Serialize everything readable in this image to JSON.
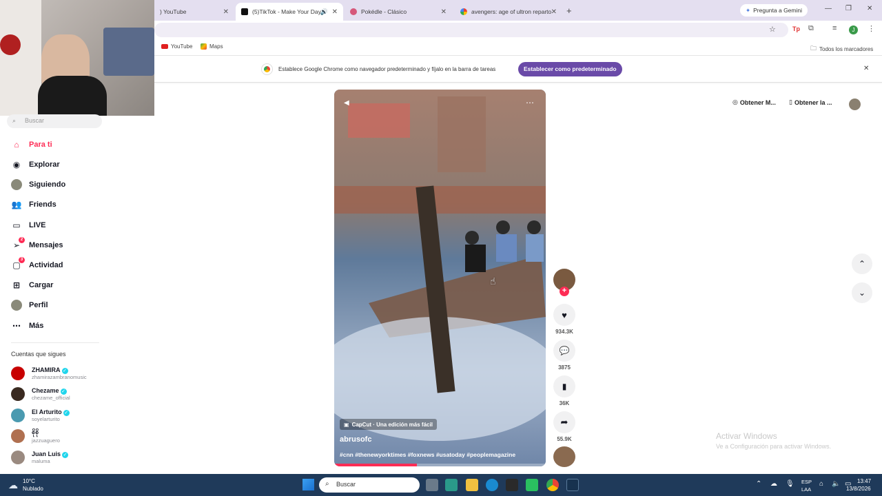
{
  "browser": {
    "tabs": [
      {
        "label": ") YouTube"
      },
      {
        "label": "(5)TikTok - Make Your Day"
      },
      {
        "label": "Pokédle - Clásico"
      },
      {
        "label": "avengers: age of ultron reparto"
      }
    ],
    "gemini_label": "Pregunta a Gemini",
    "bookmarks": [
      {
        "label": "YouTube"
      },
      {
        "label": "Maps"
      }
    ],
    "all_bookmarks": "Todos los marcadores",
    "infobar": {
      "message": "Establece Google Chrome como navegador predeterminado y fíjalo en la barra de tareas",
      "button": "Establecer como predeterminado"
    }
  },
  "sidebar": {
    "search_placeholder": "Buscar",
    "nav": [
      {
        "label": "Para ti",
        "icon": "home-icon"
      },
      {
        "label": "Explorar",
        "icon": "compass-icon"
      },
      {
        "label": "Siguiendo",
        "icon": "avatar-icon"
      },
      {
        "label": "Friends",
        "icon": "friends-icon"
      },
      {
        "label": "LIVE",
        "icon": "live-icon"
      },
      {
        "label": "Mensajes",
        "icon": "messages-icon",
        "badge": "2"
      },
      {
        "label": "Actividad",
        "icon": "activity-icon",
        "badge": "3"
      },
      {
        "label": "Cargar",
        "icon": "upload-icon"
      },
      {
        "label": "Perfil",
        "icon": "profile-icon"
      },
      {
        "label": "Más",
        "icon": "more-icon"
      }
    ],
    "following_title": "Cuentas que sigues",
    "following": [
      {
        "name": "ZHAMIRA",
        "handle": "zhamirazambranomusic",
        "verified": true,
        "color": "#c80000"
      },
      {
        "name": "Chezame",
        "handle": "chezame_official",
        "verified": true,
        "color": "#3a2a20"
      },
      {
        "name": "El Arturito",
        "handle": "soyelarturito",
        "verified": true,
        "color": "#4a9ab0"
      },
      {
        "name": "စိုစို",
        "handle": "jazzuaguero",
        "verified": false,
        "color": "#b07050"
      },
      {
        "name": "Juan Luis",
        "handle": "maluma",
        "verified": true,
        "color": "#9a8a80"
      }
    ]
  },
  "header": {
    "coins_label": "Obtener M...",
    "app_label": "Obtener la ..."
  },
  "video": {
    "capcut": "CapCut · Una edición más fácil",
    "author": "abrusofc",
    "hashtags": "#cnn #thenewyorktimes #foxnews #usatoday #peoplemagazine",
    "progress": 0.39
  },
  "actions": {
    "likes": "934.3K",
    "comments": "3875",
    "saves": "36K",
    "shares": "55.9K"
  },
  "watermark": {
    "title": "Activar Windows",
    "subtitle": "Ve a Configuración para activar Windows."
  },
  "taskbar": {
    "weather_temp": "10°C",
    "weather_desc": "Nublado",
    "search": "Buscar",
    "lang1": "ESP",
    "lang2": "LAA",
    "time": "13:47",
    "date": "13/8/2026"
  },
  "colors": {
    "accent": "#fe2c55",
    "infobar_button": "#6a4aa8",
    "taskbar": "#1f3a5a"
  }
}
